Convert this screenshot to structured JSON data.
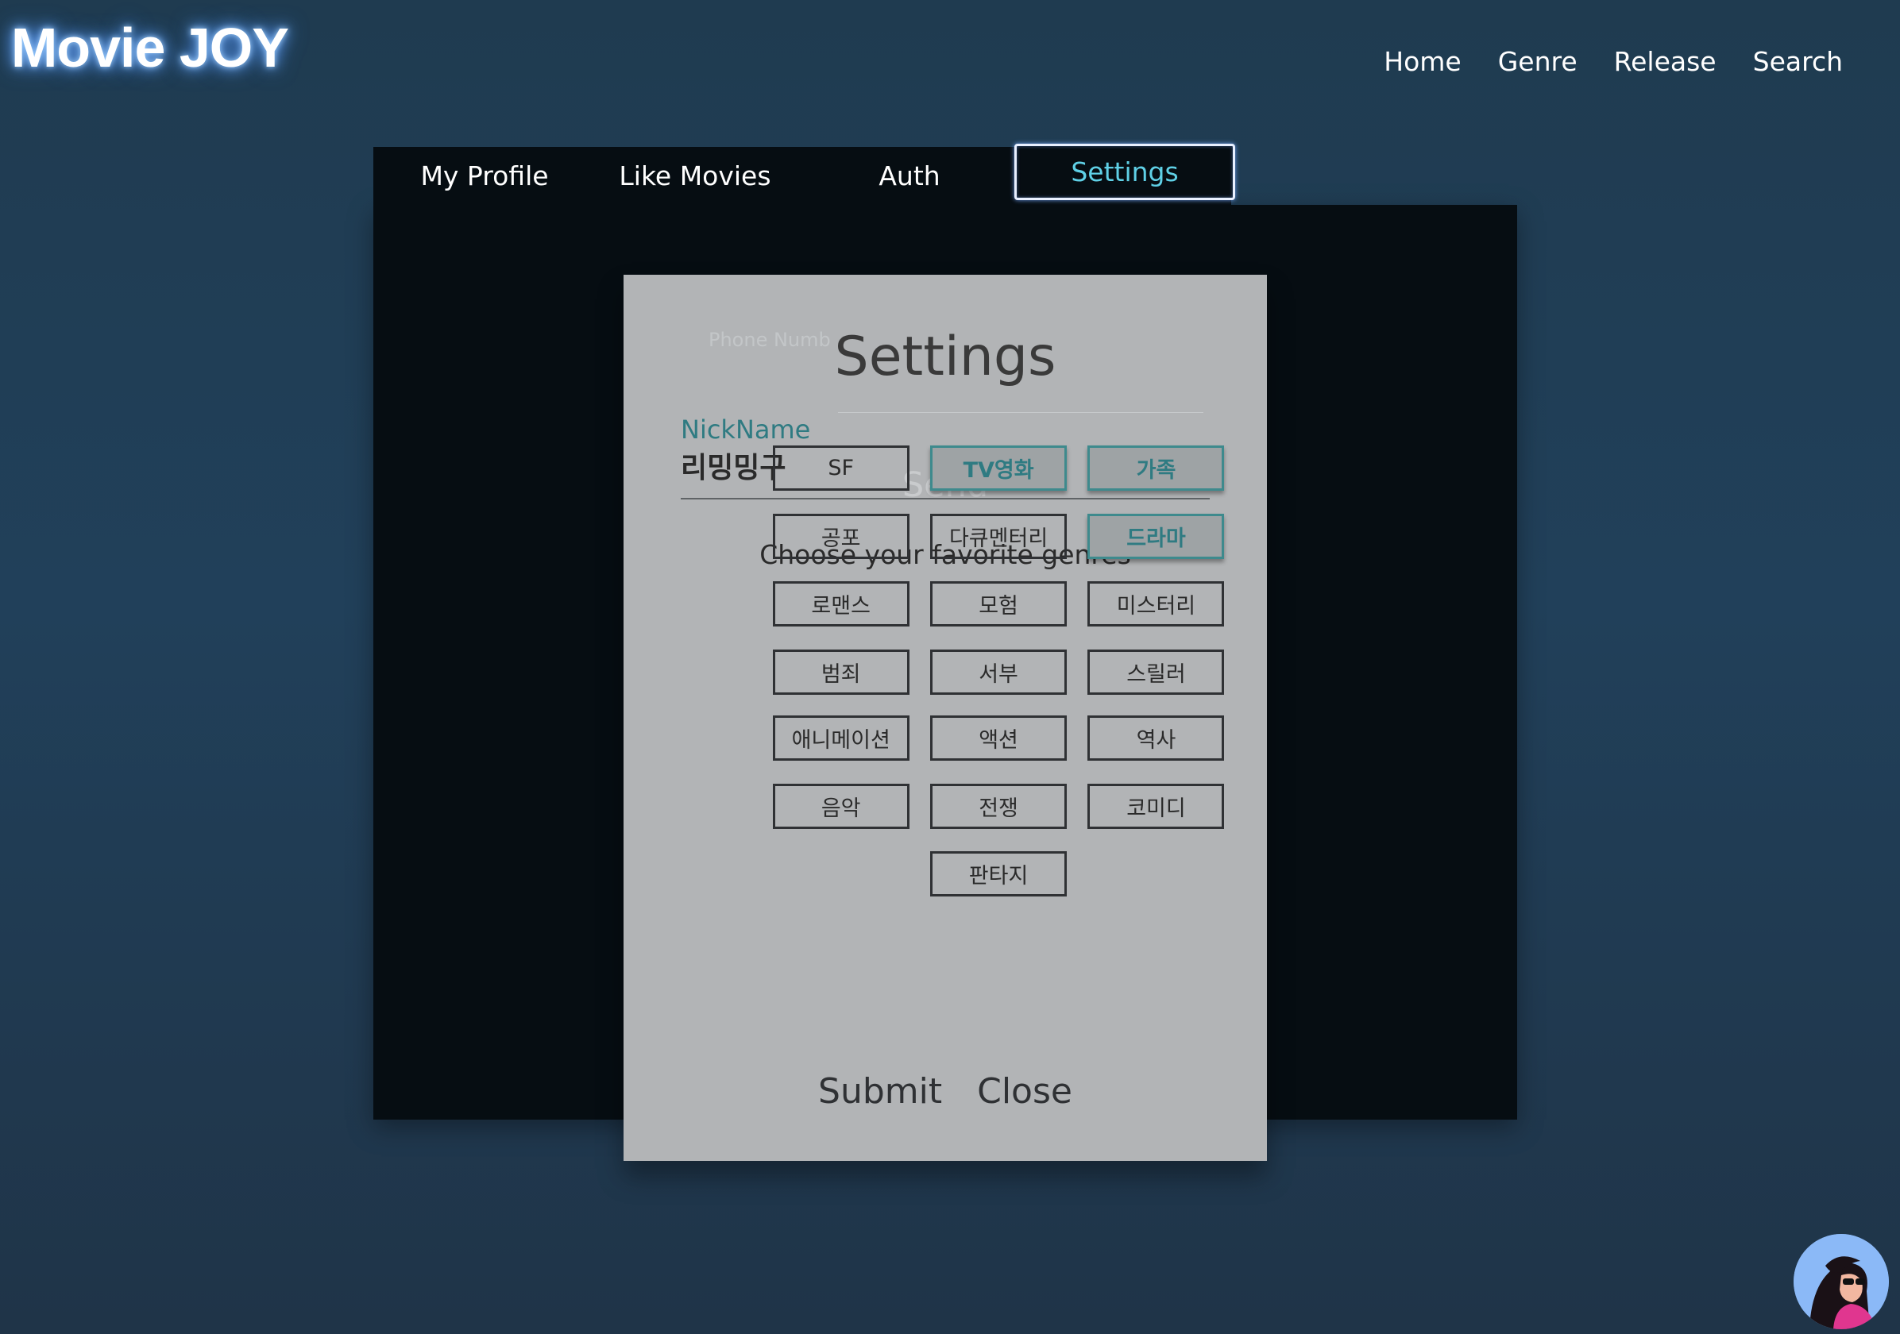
{
  "app": {
    "logo": "Movie JOY"
  },
  "topnav": {
    "items": [
      "Home",
      "Genre",
      "Release",
      "Search"
    ]
  },
  "tabs": [
    {
      "label": "My Profile"
    },
    {
      "label": "Like Movies"
    },
    {
      "label": "Auth"
    },
    {
      "label": "Settings",
      "active": true
    }
  ],
  "modal": {
    "title": "Settings",
    "ghost_phone": "Phone Numb",
    "ghost_send": "Send",
    "nickname_label": "NickName",
    "nickname_value": "리밍밍구",
    "genres_label": "Choose your favorite genres",
    "genres": [
      {
        "label": "SF",
        "selected": false
      },
      {
        "label": "TV영화",
        "selected": true
      },
      {
        "label": "가족",
        "selected": true
      },
      {
        "label": "공포",
        "selected": false
      },
      {
        "label": "다큐멘터리",
        "selected": false
      },
      {
        "label": "드라마",
        "selected": true
      },
      {
        "label": "로맨스",
        "selected": false
      },
      {
        "label": "모험",
        "selected": false
      },
      {
        "label": "미스터리",
        "selected": false
      },
      {
        "label": "범죄",
        "selected": false
      },
      {
        "label": "서부",
        "selected": false
      },
      {
        "label": "스릴러",
        "selected": false
      },
      {
        "label": "애니메이션",
        "selected": false
      },
      {
        "label": "액션",
        "selected": false
      },
      {
        "label": "역사",
        "selected": false
      },
      {
        "label": "음악",
        "selected": false
      },
      {
        "label": "전쟁",
        "selected": false
      },
      {
        "label": "코미디",
        "selected": false
      },
      {
        "label": "판타지",
        "selected": false
      }
    ],
    "submit_label": "Submit",
    "close_label": "Close"
  },
  "colors": {
    "accent_teal": "#2f7b82",
    "active_tab_text": "#5fd0e6",
    "modal_bg": "#b2b4b6"
  }
}
